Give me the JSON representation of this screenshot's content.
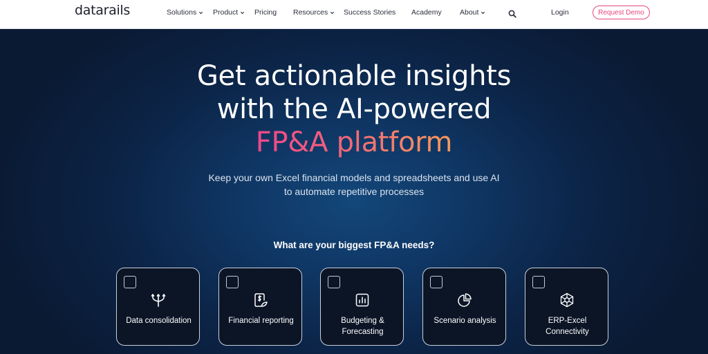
{
  "brand": {
    "logo_text": "datarails"
  },
  "nav": {
    "items": [
      {
        "label": "Solutions",
        "has_dropdown": true
      },
      {
        "label": "Product",
        "has_dropdown": true
      },
      {
        "label": "Pricing",
        "has_dropdown": false
      },
      {
        "label": "Resources",
        "has_dropdown": true
      },
      {
        "label": "Success Stories",
        "has_dropdown": false
      },
      {
        "label": "Academy",
        "has_dropdown": false
      },
      {
        "label": "About",
        "has_dropdown": true
      }
    ],
    "search_icon": "search-icon",
    "login_label": "Login",
    "cta_label": "Request Demo"
  },
  "hero": {
    "headline_line1": "Get actionable insights",
    "headline_line2": "with the AI-powered",
    "headline_accent": "FP&A platform",
    "subheadline_line1": "Keep your own Excel financial models and spreadsheets and use AI",
    "subheadline_line2": "to automate repetitive processes",
    "question": "What are your biggest FP&A needs?"
  },
  "needs": [
    {
      "label_line1": "Data consolidation",
      "label_line2": "",
      "icon": "merge-arrows-icon",
      "checked": false
    },
    {
      "label_line1": "Financial reporting",
      "label_line2": "",
      "icon": "dollar-document-icon",
      "checked": false
    },
    {
      "label_line1": "Budgeting &",
      "label_line2": "Forecasting",
      "icon": "bar-chart-icon",
      "checked": false
    },
    {
      "label_line1": "Scenario analysis",
      "label_line2": "",
      "icon": "pie-chart-icon",
      "checked": false
    },
    {
      "label_line1": "ERP-Excel",
      "label_line2": "Connectivity",
      "icon": "network-hub-icon",
      "checked": false
    }
  ],
  "colors": {
    "accent_pink": "#f0468a",
    "accent_orange": "#f59a5a",
    "hero_bg": "#0a1a33",
    "nav_bg": "#ffffff"
  }
}
